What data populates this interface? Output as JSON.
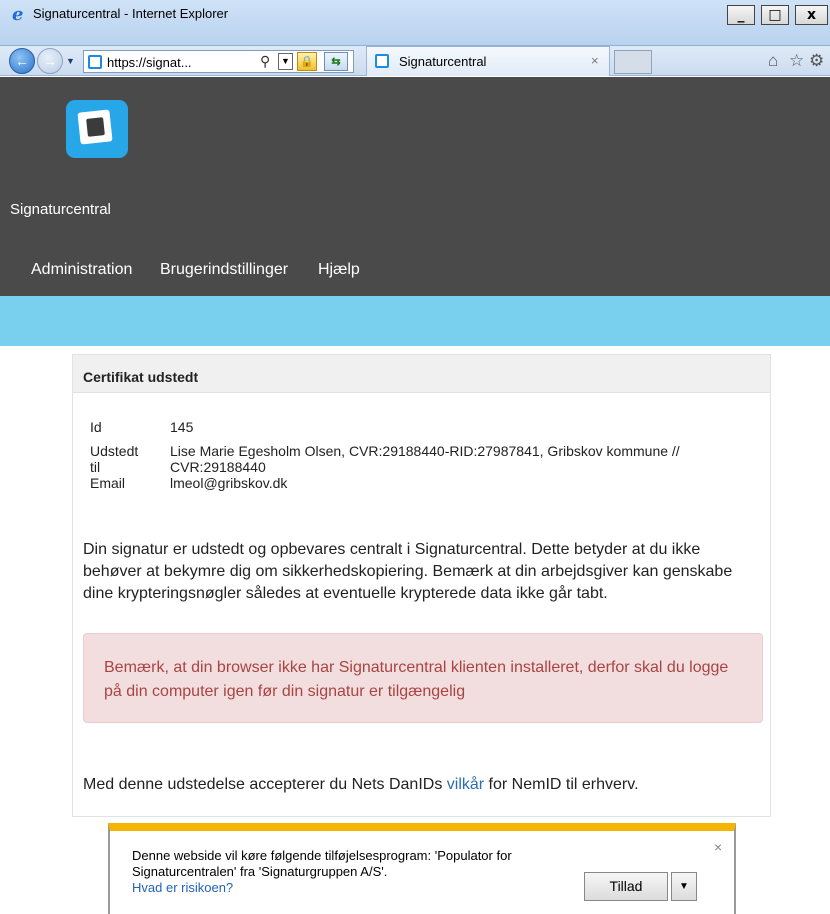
{
  "window": {
    "title": "Signaturcentral - Internet Explorer",
    "buttons": {
      "minimize": "_",
      "maximize": "□",
      "close": "x"
    }
  },
  "browser": {
    "address": "https://signat...",
    "tab_label": "Signaturcentral",
    "tab_close": "×"
  },
  "site": {
    "brand": "Signaturcentral",
    "menu": [
      "Administration",
      "Brugerindstillinger",
      "Hjælp"
    ]
  },
  "panel": {
    "title": "Certifikat udstedt",
    "fields": [
      {
        "label": "Id",
        "value": "145"
      },
      {
        "label": "Udstedt til",
        "value": "Lise Marie Egesholm Olsen, CVR:29188440-RID:27987841, Gribskov kommune // CVR:29188440"
      },
      {
        "label": "Email",
        "value": "lmeol@gribskov.dk"
      }
    ],
    "paragraph": "Din signatur er udstedt og opbevares centralt i Signaturcentral. Dette betyder at du ikke behøver at bekymre dig om sikkerhedskopiering. Bemærk at din arbejdsgiver kan genskabe dine krypteringsnøgler således at eventuelle krypterede data ikke går tabt.",
    "alert": "Bemærk, at din browser ikke har Signaturcentral klienten installeret, derfor skal du logge på din computer igen før din signatur er tilgængelig",
    "terms_before": "Med denne udstedelse accepterer du Nets DanIDs ",
    "terms_link": "vilkår",
    "terms_after": " for NemID til erhverv."
  },
  "notification": {
    "text": "Denne webside vil køre følgende tilføjelsesprogram: 'Populator for Signaturcentralen' fra 'Signaturgruppen A/S'.",
    "link": "Hvad er risikoen?",
    "allow_button": "Tillad",
    "close": "×"
  },
  "colors": {
    "header_bg": "#4a4a4a",
    "accent_bar": "#78cfee",
    "logo_blue": "#27a7e8",
    "alert_text": "#a94442",
    "alert_bg": "#f2dede",
    "notify_accent": "#f4b400"
  }
}
